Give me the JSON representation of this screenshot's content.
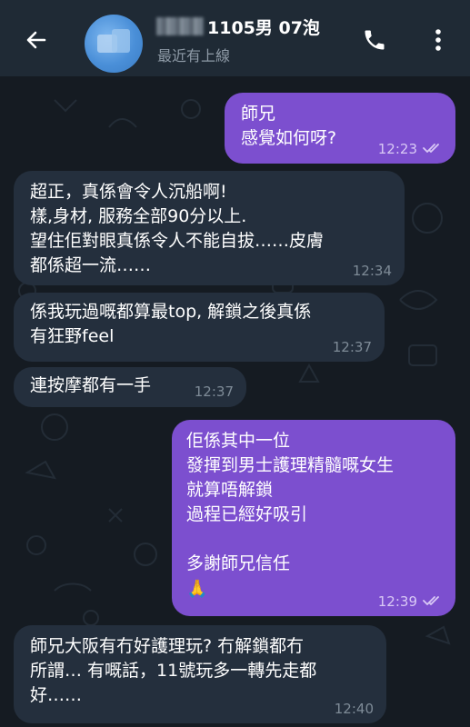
{
  "header": {
    "contact_name": "1105男 07泡",
    "status": "最近有上線",
    "back_icon": "back-arrow-icon",
    "call_icon": "phone-icon",
    "menu_icon": "more-vertical-icon"
  },
  "colors": {
    "header_bg": "#1f2a35",
    "incoming_bubble": "#242f3d",
    "outgoing_bubble": "#7c4fcf",
    "chat_bg": "#151b22"
  },
  "messages": [
    {
      "direction": "out",
      "text": "師兄\n感覺如何呀?",
      "time": "12:23",
      "read": true
    },
    {
      "direction": "in",
      "text": "超正，真係會令人沉船啊!\n樣,身材, 服務全部90分以上.\n望住佢對眼真係令人不能自拔……皮膚\n都係超一流……",
      "time": "12:34"
    },
    {
      "direction": "in",
      "text": "係我玩過嘅都算最top, 解鎖之後真係\n有狂野feel",
      "time": "12:37"
    },
    {
      "direction": "in",
      "text": "連按摩都有一手",
      "time": "12:37"
    },
    {
      "direction": "out",
      "text": "佢係其中一位\n發揮到男士護理精髓嘅女生\n就算唔解鎖\n過程已經好吸引\n\n多謝師兄信任",
      "emoji": "🙏",
      "time": "12:39",
      "read": true
    },
    {
      "direction": "in",
      "text": "師兄大阪有冇好護理玩? 冇解鎖都冇\n所謂… 有嘅話，11號玩多一轉先走都\n好……",
      "time": "12:40"
    }
  ]
}
